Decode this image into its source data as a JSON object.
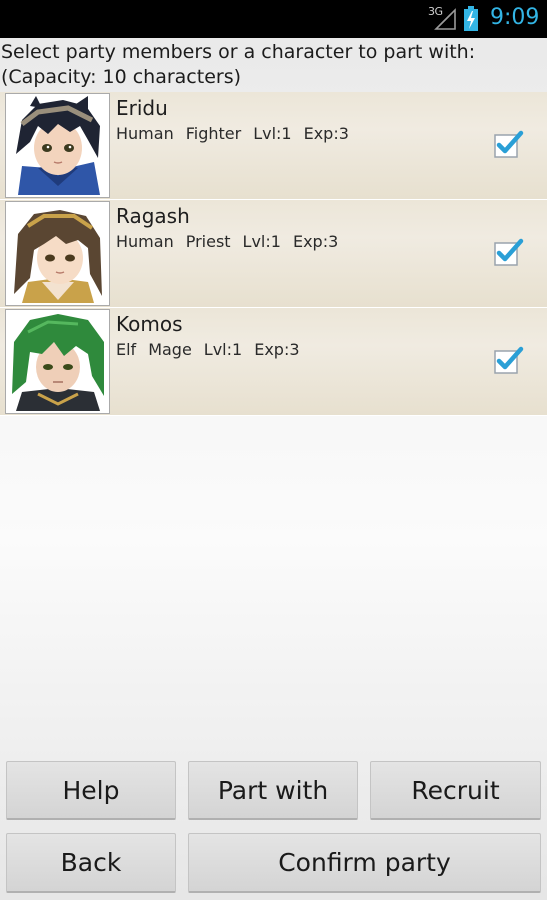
{
  "status_bar": {
    "network": "3G",
    "time": "9:09",
    "time_color": "#33b5e5"
  },
  "instructions": {
    "line1": "Select party members or a character to part with:",
    "line2": "(Capacity: 10 characters)"
  },
  "characters": [
    {
      "name": "Eridu",
      "race": "Human",
      "class": "Fighter",
      "level": "Lvl:1",
      "exp": "Exp:3",
      "checked": true,
      "portrait": "dark-haired-fighter-portrait"
    },
    {
      "name": "Ragash",
      "race": "Human",
      "class": "Priest",
      "level": "Lvl:1",
      "exp": "Exp:3",
      "checked": true,
      "portrait": "brown-haired-priest-portrait"
    },
    {
      "name": "Komos",
      "race": "Elf",
      "class": "Mage",
      "level": "Lvl:1",
      "exp": "Exp:3",
      "checked": true,
      "portrait": "green-haired-mage-portrait"
    }
  ],
  "buttons": {
    "help": "Help",
    "part_with": "Part with",
    "recruit": "Recruit",
    "back": "Back",
    "confirm": "Confirm party"
  },
  "colors": {
    "accent": "#33b5e5",
    "check": "#2a9fd6",
    "row_bg": "#ece6d8"
  }
}
